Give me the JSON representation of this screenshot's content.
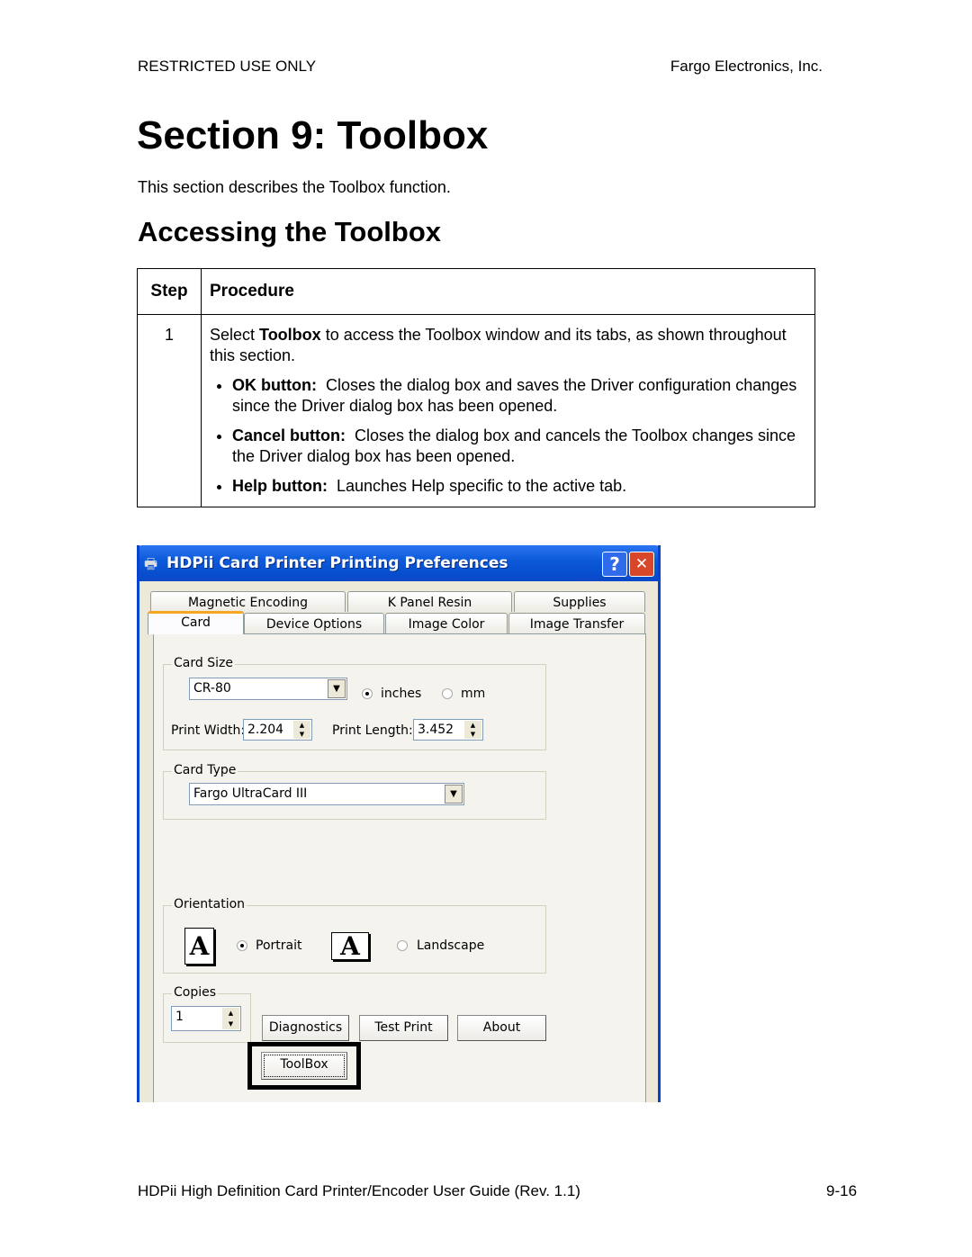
{
  "header": {
    "left": "RESTRICTED USE ONLY",
    "right": "Fargo Electronics, Inc."
  },
  "title": "Section 9: Toolbox",
  "intro": "This section describes the Toolbox function.",
  "subtitle": "Accessing the Toolbox",
  "table": {
    "headers": [
      "Step",
      "Procedure"
    ],
    "rows": [
      {
        "step": "1",
        "pre": "Select ",
        "bold": "Toolbox",
        "post": " to access the Toolbox window and its tabs, as shown throughout this section.",
        "bullets": [
          {
            "label": "OK button:",
            "text": "  Closes the dialog box and saves the Driver configuration changes since the Driver dialog box has been opened."
          },
          {
            "label": "Cancel button:",
            "text": "  Closes the dialog box and cancels the Toolbox changes since the Driver dialog box has been opened."
          },
          {
            "label": "Help button:",
            "text": "  Launches Help specific to the active tab."
          }
        ]
      }
    ]
  },
  "dialog": {
    "title": "HDPii Card Printer Printing Preferences",
    "help": "?",
    "close": "✕",
    "tabs_top": [
      "Magnetic Encoding",
      "K Panel Resin",
      "Supplies"
    ],
    "tabs_bottom": [
      "Card",
      "Device Options",
      "Image Color",
      "Image Transfer"
    ],
    "active_tab": "Card",
    "card_size": {
      "legend": "Card Size",
      "value": "CR-80",
      "units": [
        "inches",
        "mm"
      ],
      "selected_unit": "inches",
      "print_width_label": "Print Width:",
      "print_width": "2.204",
      "print_length_label": "Print Length:",
      "print_length": "3.452"
    },
    "card_type": {
      "legend": "Card Type",
      "value": "Fargo UltraCard III"
    },
    "orientation": {
      "legend": "Orientation",
      "options": [
        "Portrait",
        "Landscape"
      ],
      "selected": "Portrait",
      "icon_letter": "A"
    },
    "copies": {
      "legend": "Copies",
      "value": "1"
    },
    "buttons": [
      "Diagnostics",
      "Test Print",
      "About",
      "ToolBox"
    ],
    "colors": {
      "titlebar": "#0A58D8",
      "face": "#ECE9D8",
      "highlight": "#000000"
    }
  },
  "footer": {
    "left": "HDPii High Definition Card Printer/Encoder User Guide (Rev. 1.1)",
    "right": "9-16"
  }
}
